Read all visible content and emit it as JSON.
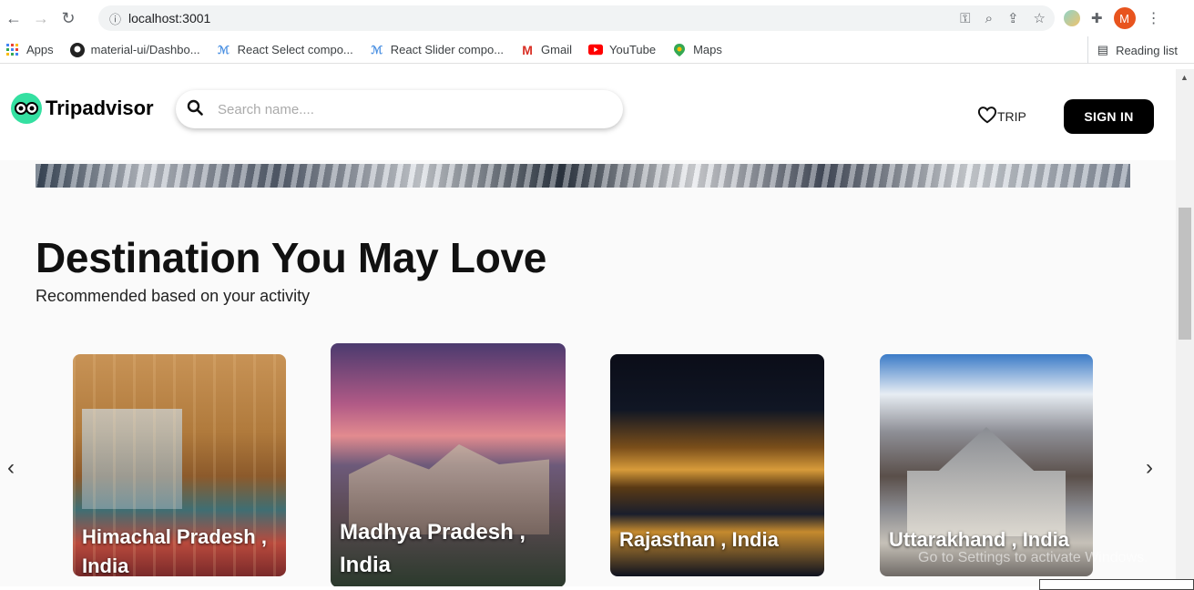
{
  "browser": {
    "url": "localhost:3001",
    "bookmarks": [
      {
        "label": "Apps",
        "icon": "apps-grid-icon"
      },
      {
        "label": "material-ui/Dashbo...",
        "icon": "github-icon"
      },
      {
        "label": "React Select compo...",
        "icon": "react-icon"
      },
      {
        "label": "React Slider compo...",
        "icon": "react-icon"
      },
      {
        "label": "Gmail",
        "icon": "gmail-icon"
      },
      {
        "label": "YouTube",
        "icon": "youtube-icon"
      },
      {
        "label": "Maps",
        "icon": "maps-icon"
      }
    ],
    "reading_list": "Reading list",
    "profile_initial": "M"
  },
  "header": {
    "brand": "Tripadvisor",
    "search_placeholder": "Search name....",
    "trip_label": "TRIP",
    "signin_label": "SIGN IN"
  },
  "section": {
    "title": "Destination You May Love",
    "subtitle": "Recommended based on your activity",
    "prev_arrow": "‹",
    "next_arrow": "›"
  },
  "cards": [
    {
      "label": "Himachal Pradesh , India"
    },
    {
      "label": "Madhya Pradesh , India"
    },
    {
      "label": "Rajasthan , India"
    },
    {
      "label": "Uttarakhand , India"
    }
  ],
  "overlay": {
    "watermark": "Go to Settings to activate Windows."
  },
  "colors": {
    "brand_green": "#34e0a1",
    "signin_bg": "#000000",
    "avatar_bg": "#e8541e"
  }
}
